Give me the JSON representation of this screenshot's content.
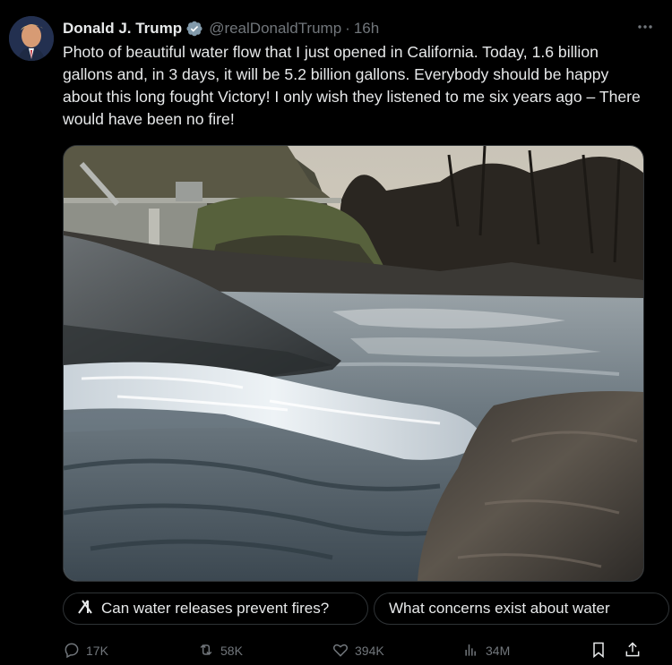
{
  "author": {
    "name": "Donald J. Trump",
    "handle": "@realDonaldTrump",
    "separator": "·",
    "time": "16h"
  },
  "tweet": {
    "text": "Photo of beautiful water flow that I just opened in California. Today, 1.6 billion gallons and, in 3 days, it will be 5.2 billion gallons. Everybody should be happy about this long fought Victory! I only wish they listened to me six years ago – There would have been no fire!"
  },
  "grok_suggestions": [
    "Can water releases prevent fires?",
    "What concerns exist about water"
  ],
  "actions": {
    "replies": "17K",
    "reposts": "58K",
    "likes": "394K",
    "views": "34M"
  },
  "colors": {
    "background": "#000000",
    "text": "#e7e9ea",
    "muted": "#71767b",
    "border": "#2f3336",
    "verified": "#1d9bf0"
  },
  "icons": [
    "verified-badge-icon",
    "more-options-icon",
    "grok-icon",
    "reply-icon",
    "repost-icon",
    "like-icon",
    "views-icon",
    "bookmark-icon",
    "share-icon"
  ]
}
